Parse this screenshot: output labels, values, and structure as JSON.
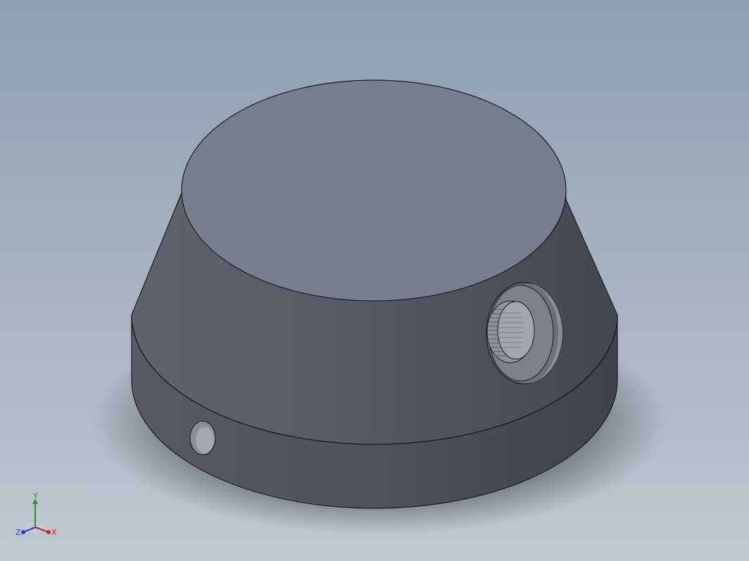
{
  "viewport": {
    "background_top": "#8d9fb3",
    "background_bottom": "#c0c7d2"
  },
  "part": {
    "color_top_face": "#787d90",
    "color_side": "#565a67",
    "color_band": "#4f525e",
    "color_edge": "#1a1a1e",
    "features": [
      "top-face",
      "tapered-side",
      "cylindrical-band",
      "threaded-port-hole",
      "pin-hole"
    ]
  },
  "triad": {
    "y_label": "Y",
    "x_label": "X",
    "z_label": "Z",
    "y_color": "#1e9a2e",
    "x_color": "#c4262b",
    "z_color": "#2b3fb8"
  }
}
